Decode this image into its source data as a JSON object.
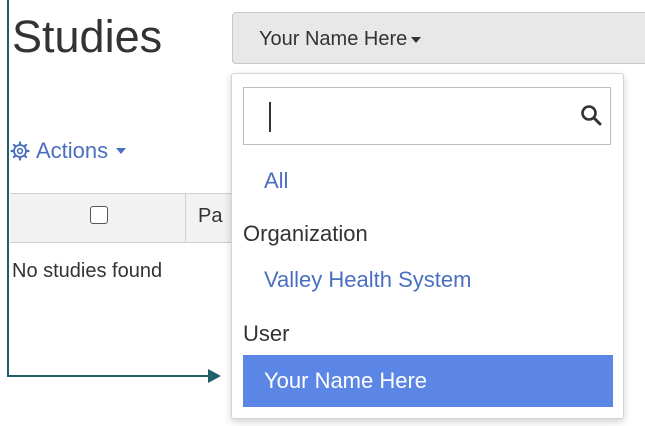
{
  "page": {
    "title": "Studies"
  },
  "user_select": {
    "label": "Your Name Here"
  },
  "actions": {
    "label": "Actions"
  },
  "table": {
    "header_col": "Pa",
    "empty_message": "No studies found"
  },
  "dropdown": {
    "search": {
      "value": "",
      "placeholder": ""
    },
    "all_option": "All",
    "groups": [
      {
        "label": "Organization",
        "options": [
          "Valley Health System"
        ]
      },
      {
        "label": "User",
        "options": [
          "Your Name Here"
        ]
      }
    ],
    "selected": "Your Name Here"
  },
  "colors": {
    "link": "#4a6fc1",
    "selected_bg": "#5b86e5",
    "frame": "#1e5f69"
  }
}
